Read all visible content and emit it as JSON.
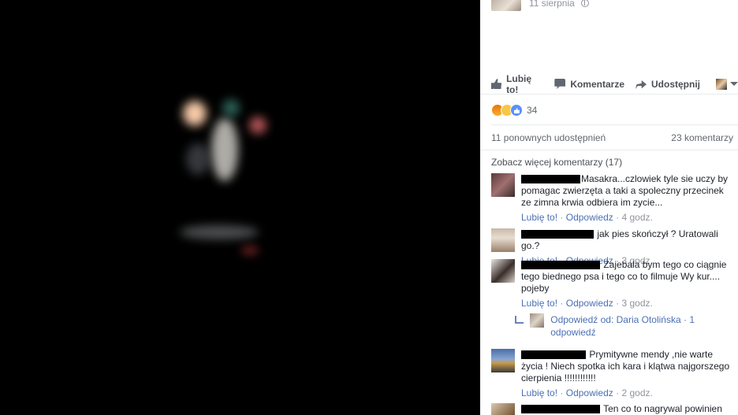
{
  "post": {
    "date": "11 sierpnia",
    "globe_icon": "globe-icon"
  },
  "actions": {
    "like": "Lubię to!",
    "comment": "Komentarze",
    "share": "Udostępnij"
  },
  "reactions": {
    "count": "34",
    "types": [
      "angry",
      "sad",
      "like"
    ]
  },
  "stats": {
    "shares": "11 ponownych udostępnień",
    "comments": "23 komentarzy"
  },
  "more_comments": "Zobacz więcej komentarzy (17)",
  "comments": [
    {
      "text": "Masakra...czlowiek tyle sie uczy by pomagac zwierzęta a taki a spoleczny przecinek ze zimna krwia odbiera im zycie...",
      "like": "Lubię to!",
      "reply": "Odpowiedz",
      "time": "4 godz."
    },
    {
      "text": "jak pies skończył ? Uratowali go.?",
      "like": "Lubię to!",
      "reply": "Odpowiedz",
      "time": "3 godz."
    },
    {
      "text": "Zajebala bym tego co ciągnie tego biednego psa i tego co to filmuje Wy kur.... pojeby",
      "like": "Lubię to!",
      "reply": "Odpowiedz",
      "time": "3 godz.",
      "replies_link": "Odpowiedź od: Daria Otolińska · 1 odpowiedź"
    },
    {
      "text": "Prymitywne mendy ,nie warte życia ! Niech spotka ich kara i klątwa najgorszego cierpienia !!!!!!!!!!!!",
      "like": "Lubię to!",
      "reply": "Odpowiedz",
      "time": "2 godz."
    },
    {
      "text": "Ten co to nagrywal powinien"
    }
  ],
  "separator": "·",
  "colors": {
    "link": "#4b70b4",
    "meta": "#90949c",
    "reaction_like": "#5890ff"
  }
}
